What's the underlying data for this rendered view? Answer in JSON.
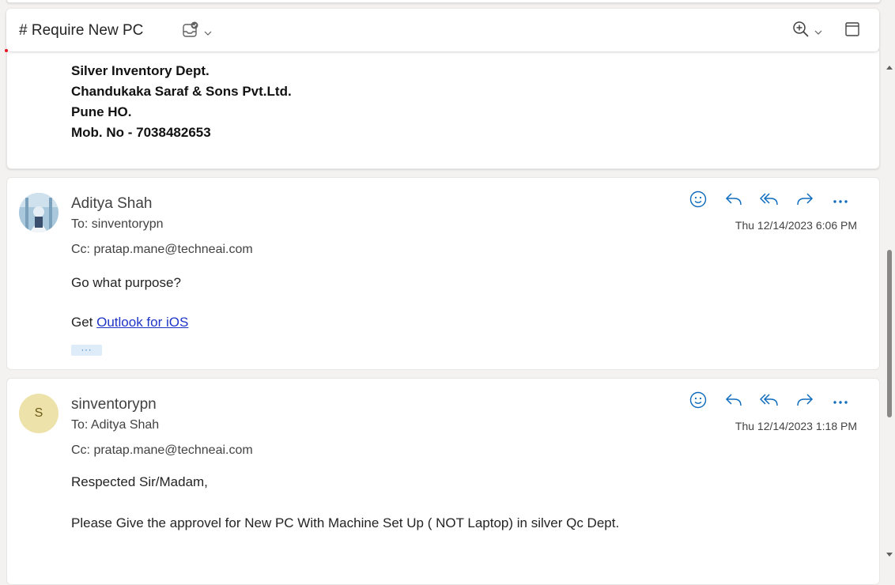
{
  "header": {
    "subject": "# Require New PC"
  },
  "signature": {
    "lines": [
      "Silver Inventory Dept.",
      "Chandukaka Saraf & Sons Pvt.Ltd.",
      "Pune HO.",
      "Mob. No - 7038482653"
    ]
  },
  "messages": [
    {
      "sender": "Aditya Shah",
      "to": "To:  sinventorypn",
      "cc": "Cc:  pratap.mane@techneai.com",
      "date": "Thu 12/14/2023 6:06 PM",
      "body_line1": "Go what purpose?",
      "body_prefix": "Get ",
      "link_text": "Outlook for iOS",
      "more_label": "···"
    },
    {
      "sender": "sinventorypn",
      "avatar_initial": "S",
      "to": "To:  Aditya Shah",
      "cc": "Cc:  pratap.mane@techneai.com",
      "date": "Thu 12/14/2023 1:18 PM",
      "body_line1": "Respected Sir/Madam,",
      "body_line2": "Please Give the approvel for New PC With Machine Set Up ( NOT Laptop) in silver Qc Dept."
    }
  ],
  "icons": {
    "header": [
      "mark-read-icon",
      "chevron-down-icon",
      "zoom-in-icon",
      "chevron-down-icon",
      "open-new-window-icon"
    ],
    "message_actions": [
      "emoji-react-icon",
      "reply-icon",
      "reply-all-icon",
      "forward-icon",
      "more-actions-icon"
    ]
  },
  "colors": {
    "accent": "#0f6cbd",
    "link": "#1f35c7",
    "avatar_initial_bg": "#ede2a9",
    "more_pill_bg": "#deecf9"
  }
}
